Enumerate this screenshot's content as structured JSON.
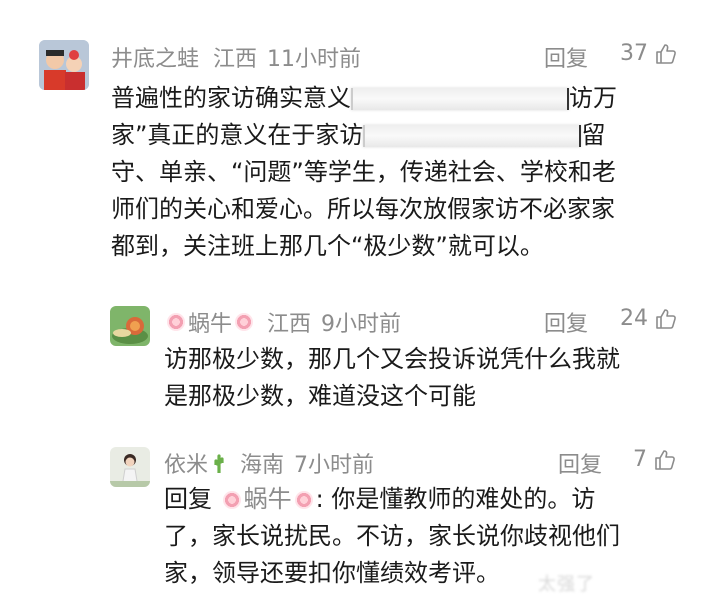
{
  "comments": [
    {
      "username": "井底之蛙",
      "region": "江西",
      "time": "11小时前",
      "reply_label": "回复",
      "likes": "37",
      "line1_a": "普遍性的家访确实意义",
      "line1_b": "访万",
      "line2_a": "家”真正的意义在于家访",
      "line2_b": "留",
      "line3": "守、单亲、“问题”等学生，传递社会、学校和老",
      "line4": "师们的关心和爱心。所以每次放假家访不必家家",
      "line5": "都到，关注班上那几个“极少数”就可以。"
    },
    {
      "username": "蜗牛",
      "region": "江西",
      "time": "9小时前",
      "reply_label": "回复",
      "likes": "24",
      "line1": "访那极少数，那几个又会投诉说凭什么我就",
      "line2": "是那极少数，难道没这个可能"
    },
    {
      "username": "依米",
      "region": "海南",
      "time": "7小时前",
      "reply_label": "回复",
      "likes": "7",
      "reply_prefix": "回复",
      "reply_to": "蜗牛",
      "line1_rest": ": 你是懂教师的难处的。访",
      "line2": "了，家长说扰民。不访，家长说你歧视他们",
      "line3": "家，领导还要扣你懂绩效考评。"
    }
  ],
  "watermark": "太强了"
}
